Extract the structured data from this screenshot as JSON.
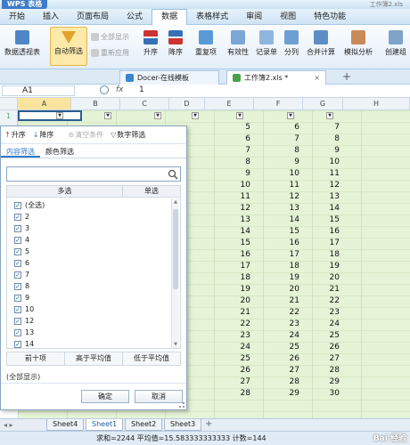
{
  "app": {
    "badge": "WPS 表格",
    "window_title": "工作簿2.xls"
  },
  "menu": [
    "开始",
    "插入",
    "页面布局",
    "公式",
    "数据",
    "表格样式",
    "审阅",
    "视图",
    "特色功能"
  ],
  "menu_active": "数据",
  "ribbon": {
    "pivot": "数据透视表",
    "autofilter": "自动筛选",
    "show_all": "全部显示",
    "reapply": "重新应用",
    "sort_asc": "升序",
    "sort_desc": "降序",
    "duplicates": "重复项",
    "validity": "有效性",
    "record": "记录单",
    "split": "分列",
    "consolidate": "合并计算",
    "simulate": "模拟分析",
    "group": "创建组"
  },
  "doc_tabs": [
    "Docer-在线模板",
    "工作簿2.xls *"
  ],
  "formula_bar": {
    "name_box": "A1",
    "fx": "fx",
    "value": "1"
  },
  "columns": [
    "A",
    "B",
    "C",
    "D",
    "E",
    "F",
    "G",
    "H"
  ],
  "rows": [
    {
      "num": "1"
    },
    {
      "num": "",
      "e": "5",
      "f": "6",
      "g": "7"
    },
    {
      "num": "",
      "e": "6",
      "f": "7",
      "g": "8"
    },
    {
      "num": "",
      "e": "7",
      "f": "8",
      "g": "9"
    },
    {
      "num": "",
      "e": "8",
      "f": "9",
      "g": "10"
    },
    {
      "num": "",
      "e": "9",
      "f": "10",
      "g": "11"
    },
    {
      "num": "",
      "e": "10",
      "f": "11",
      "g": "12"
    },
    {
      "num": "",
      "e": "11",
      "f": "12",
      "g": "13"
    },
    {
      "num": "",
      "e": "12",
      "f": "13",
      "g": "14"
    },
    {
      "num": "",
      "e": "13",
      "f": "14",
      "g": "15"
    },
    {
      "num": "",
      "e": "14",
      "f": "15",
      "g": "16"
    },
    {
      "num": "",
      "e": "15",
      "f": "16",
      "g": "17"
    },
    {
      "num": "",
      "e": "16",
      "f": "17",
      "g": "18"
    },
    {
      "num": "",
      "e": "17",
      "f": "18",
      "g": "19"
    },
    {
      "num": "",
      "e": "18",
      "f": "19",
      "g": "20"
    },
    {
      "num": "",
      "e": "19",
      "f": "20",
      "g": "21"
    },
    {
      "num": "",
      "e": "20",
      "f": "21",
      "g": "22"
    },
    {
      "num": "",
      "e": "21",
      "f": "22",
      "g": "23"
    },
    {
      "num": "",
      "e": "22",
      "f": "23",
      "g": "24"
    },
    {
      "num": "",
      "e": "23",
      "f": "24",
      "g": "25"
    },
    {
      "num": "",
      "e": "24",
      "f": "25",
      "g": "26"
    },
    {
      "num": "",
      "e": "25",
      "f": "26",
      "g": "27"
    },
    {
      "num": "",
      "e": "26",
      "f": "27",
      "g": "28"
    },
    {
      "num": "",
      "e": "27",
      "f": "28",
      "g": "29"
    },
    {
      "num": "",
      "e": "28",
      "f": "29",
      "g": "30"
    }
  ],
  "filter_popup": {
    "sort_asc": "升序",
    "sort_desc": "降序",
    "clear": "清空条件",
    "number_filter": "数字筛选",
    "tab_content": "内容筛选",
    "tab_color": "颜色筛选",
    "search_value": "",
    "col_multi": "多选",
    "col_single": "单选",
    "items": [
      "(全选)",
      "2",
      "3",
      "4",
      "5",
      "6",
      "7",
      "8",
      "9",
      "10",
      "12",
      "13",
      "14"
    ],
    "top10": "前十项",
    "above_avg": "高于平均值",
    "below_avg": "低于平均值",
    "all_shown": "(全部显示)",
    "ok": "确定",
    "cancel": "取消"
  },
  "sheets": [
    "Sheet4",
    "Sheet1",
    "Sheet2",
    "Sheet3"
  ],
  "active_sheet": "Sheet1",
  "status": "求和=2244  平均值=15.583333333333  计数=144",
  "watermark": "Bai 经验",
  "colors": {
    "accent": "#2f7bc8",
    "annotation": "#cc3333",
    "cell_bg": "#e5f3d6"
  }
}
